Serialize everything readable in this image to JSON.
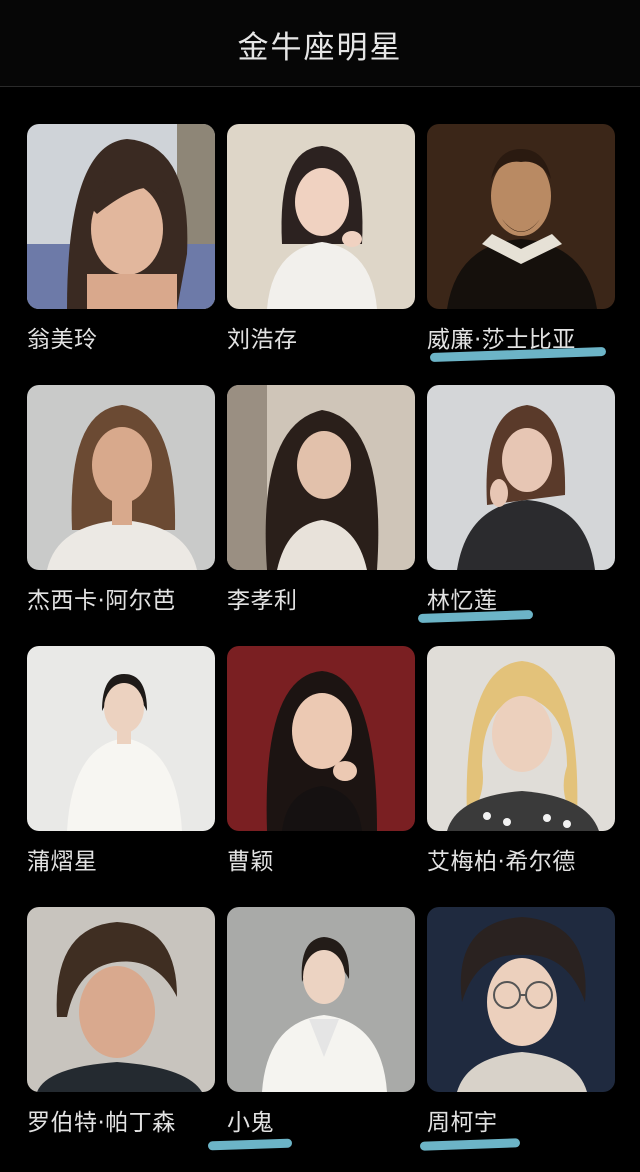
{
  "header": {
    "title": "金牛座明星"
  },
  "celebrities": [
    {
      "name": "翁美玲",
      "icon": "portrait-photo"
    },
    {
      "name": "刘浩存",
      "icon": "portrait-photo"
    },
    {
      "name": "威廉·莎士比亚",
      "icon": "portrait-painting"
    },
    {
      "name": "杰西卡·阿尔芭",
      "icon": "portrait-photo"
    },
    {
      "name": "李孝利",
      "icon": "portrait-photo"
    },
    {
      "name": "林忆莲",
      "icon": "portrait-photo"
    },
    {
      "name": "蒲熠星",
      "icon": "portrait-photo"
    },
    {
      "name": "曹颖",
      "icon": "portrait-photo"
    },
    {
      "name": "艾梅柏·希尔德",
      "icon": "portrait-photo"
    },
    {
      "name": "罗伯特·帕丁森",
      "icon": "portrait-photo"
    },
    {
      "name": "小鬼",
      "icon": "portrait-photo"
    },
    {
      "name": "周柯宇",
      "icon": "portrait-photo"
    }
  ],
  "colors": {
    "background": "#000000",
    "highlight": "#7fd3ea",
    "text": "#e2e2e2"
  }
}
